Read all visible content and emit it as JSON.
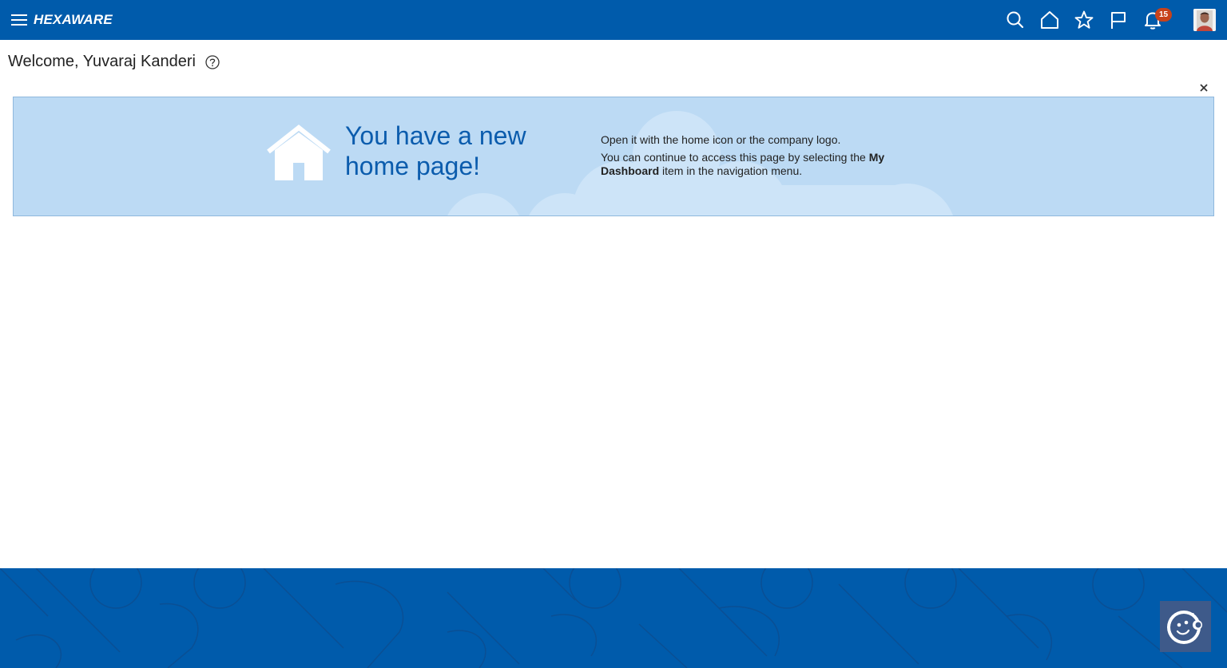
{
  "header": {
    "logo_text": "HEXAWARE",
    "notification_count": "15",
    "icons": [
      "menu-icon",
      "search-icon",
      "home-icon",
      "star-icon",
      "flag-icon",
      "bell-icon"
    ]
  },
  "welcome": {
    "text": "Welcome, Yuvaraj Kanderi"
  },
  "banner": {
    "title": "You have a new home page!",
    "line1": "Open it with the home icon or the company logo.",
    "line2_prefix": "You can continue to access this page by selecting the ",
    "line2_bold": "My Dashboard",
    "line2_suffix": " item in the navigation menu."
  },
  "colors": {
    "brand": "#005bab",
    "banner_bg": "#bcdaf4",
    "badge": "#c7421b",
    "title": "#0b5cad"
  }
}
